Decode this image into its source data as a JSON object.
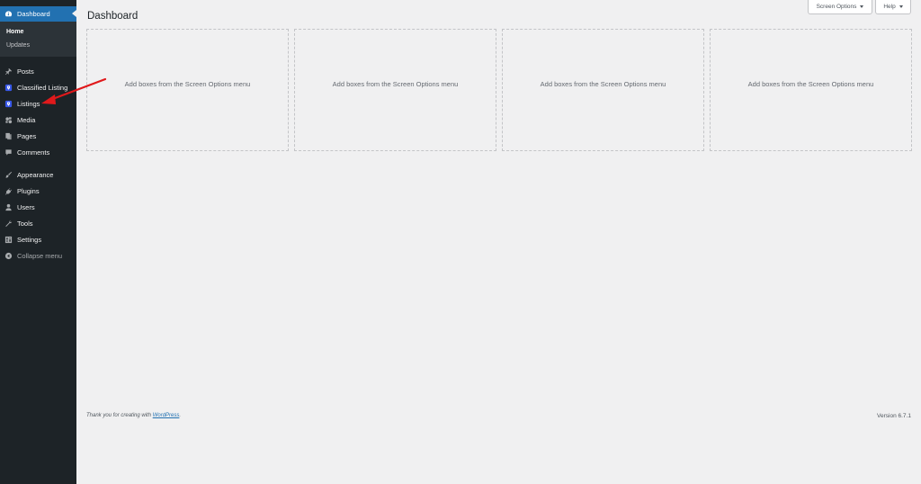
{
  "sidebar": {
    "dashboard": {
      "label": "Dashboard",
      "icon": "dashboard-icon"
    },
    "submenu": [
      {
        "label": "Home"
      },
      {
        "label": "Updates"
      }
    ],
    "items": [
      {
        "label": "Posts",
        "icon": "pin-icon"
      },
      {
        "label": "Classified Listing",
        "icon": "classified-listing-icon"
      },
      {
        "label": "Listings",
        "icon": "listings-icon"
      },
      {
        "label": "Media",
        "icon": "media-icon"
      },
      {
        "label": "Pages",
        "icon": "pages-icon"
      },
      {
        "label": "Comments",
        "icon": "comment-icon"
      },
      {
        "label": "Appearance",
        "icon": "brush-icon"
      },
      {
        "label": "Plugins",
        "icon": "plugin-icon"
      },
      {
        "label": "Users",
        "icon": "user-icon"
      },
      {
        "label": "Tools",
        "icon": "wrench-icon"
      },
      {
        "label": "Settings",
        "icon": "settings-icon"
      }
    ],
    "collapse": {
      "label": "Collapse menu",
      "icon": "collapse-icon"
    }
  },
  "header": {
    "title": "Dashboard",
    "screen_options": "Screen Options",
    "help": "Help"
  },
  "boxes": [
    {
      "text": "Add boxes from the Screen Options menu"
    },
    {
      "text": "Add boxes from the Screen Options menu"
    },
    {
      "text": "Add boxes from the Screen Options menu"
    },
    {
      "text": "Add boxes from the Screen Options menu"
    }
  ],
  "footer": {
    "thanks_prefix": "Thank you for creating with",
    "link": "WordPress",
    "thanks_suffix": ".",
    "version": "Version 6.7.1"
  },
  "colors": {
    "sidebar_bg": "#1d2327",
    "accent": "#2271b1",
    "annotation_arrow": "#e0191b"
  }
}
